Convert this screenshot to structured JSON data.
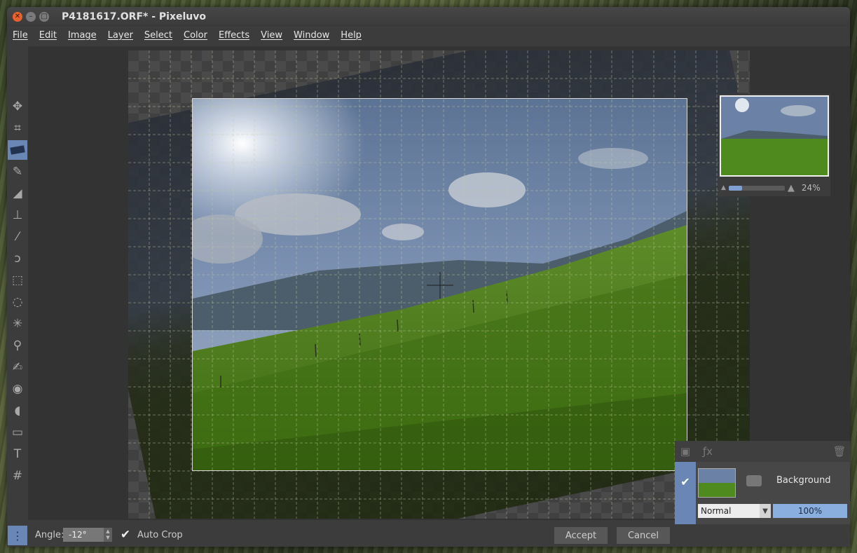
{
  "window": {
    "title": "P4181617.ORF* - Pixeluvo"
  },
  "menubar": {
    "items": [
      "File",
      "Edit",
      "Image",
      "Layer",
      "Select",
      "Color",
      "Effects",
      "View",
      "Window",
      "Help"
    ]
  },
  "toolbox": {
    "tools": [
      "move-icon",
      "crop-icon",
      "straighten-icon",
      "brush-icon",
      "eraser-icon",
      "clone-stamp-icon",
      "healing-icon",
      "lasso-icon",
      "rect-select-icon",
      "ellipse-select-icon",
      "magic-wand-icon",
      "dodge-icon",
      "smudge-icon",
      "red-eye-icon",
      "paint-bucket-icon",
      "gradient-icon",
      "text-icon",
      "perspective-icon"
    ],
    "active_index": 2
  },
  "navigator": {
    "zoom": "24%",
    "zoom_fraction": 0.24
  },
  "layers": {
    "name": "Background",
    "visible": true,
    "blend_mode": "Normal",
    "opacity": "100%"
  },
  "options_bar": {
    "angle_label": "Angle:",
    "angle_value": "-12°",
    "auto_crop_checked": true,
    "auto_crop_label": "Auto Crop",
    "accept_label": "Accept",
    "cancel_label": "Cancel"
  },
  "colors": {
    "accent": "#6a86b5",
    "close_button": "#e8622c"
  }
}
